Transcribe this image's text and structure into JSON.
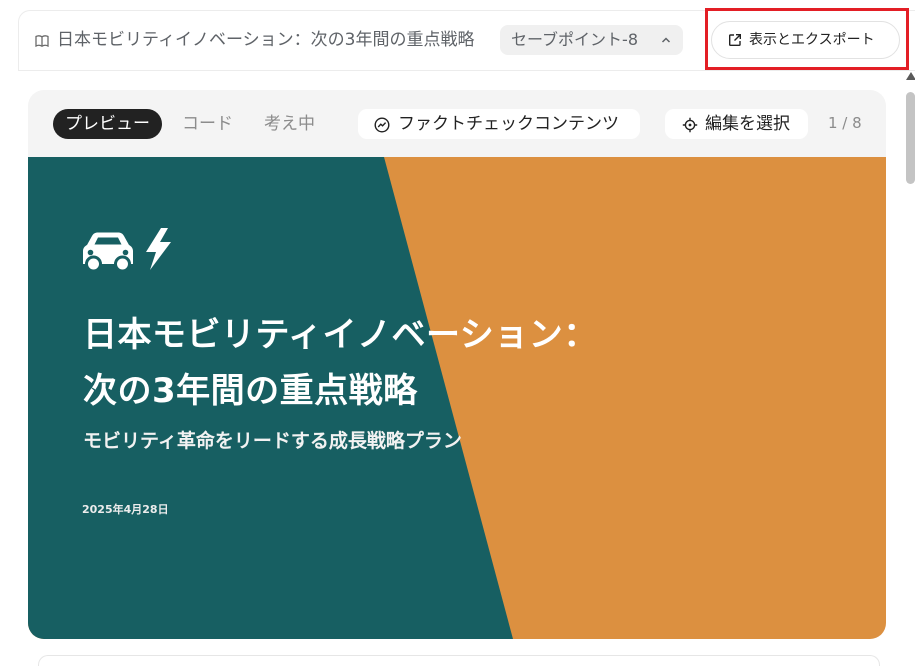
{
  "header": {
    "doc_title": "日本モビリティイノベーション：次の3年間の重点戦略",
    "save_point_label": "セーブポイント-8",
    "export_label": "表示とエクスポート"
  },
  "preview": {
    "tabs": [
      {
        "label": "プレビュー",
        "active": true
      },
      {
        "label": "コード",
        "active": false
      },
      {
        "label": "考え中",
        "active": false
      }
    ],
    "factcheck_label": "ファクトチェックコンテンツ",
    "select_edit_label": "編集を選択",
    "page_counter": "1 / 8"
  },
  "slide": {
    "title_line1": "日本モビリティイノベーション：",
    "title_line2": "次の3年間の重点戦略",
    "subtitle": "モビリティ革命をリードする成長戦略プラン",
    "date": "2025年4月28日",
    "icons": [
      "car-icon",
      "lightning-bolt-icon"
    ]
  },
  "colors": {
    "slide_teal": "#175f62",
    "slide_orange": "#dc9040",
    "highlight": "#e31e25",
    "active_tab": "#222222"
  }
}
